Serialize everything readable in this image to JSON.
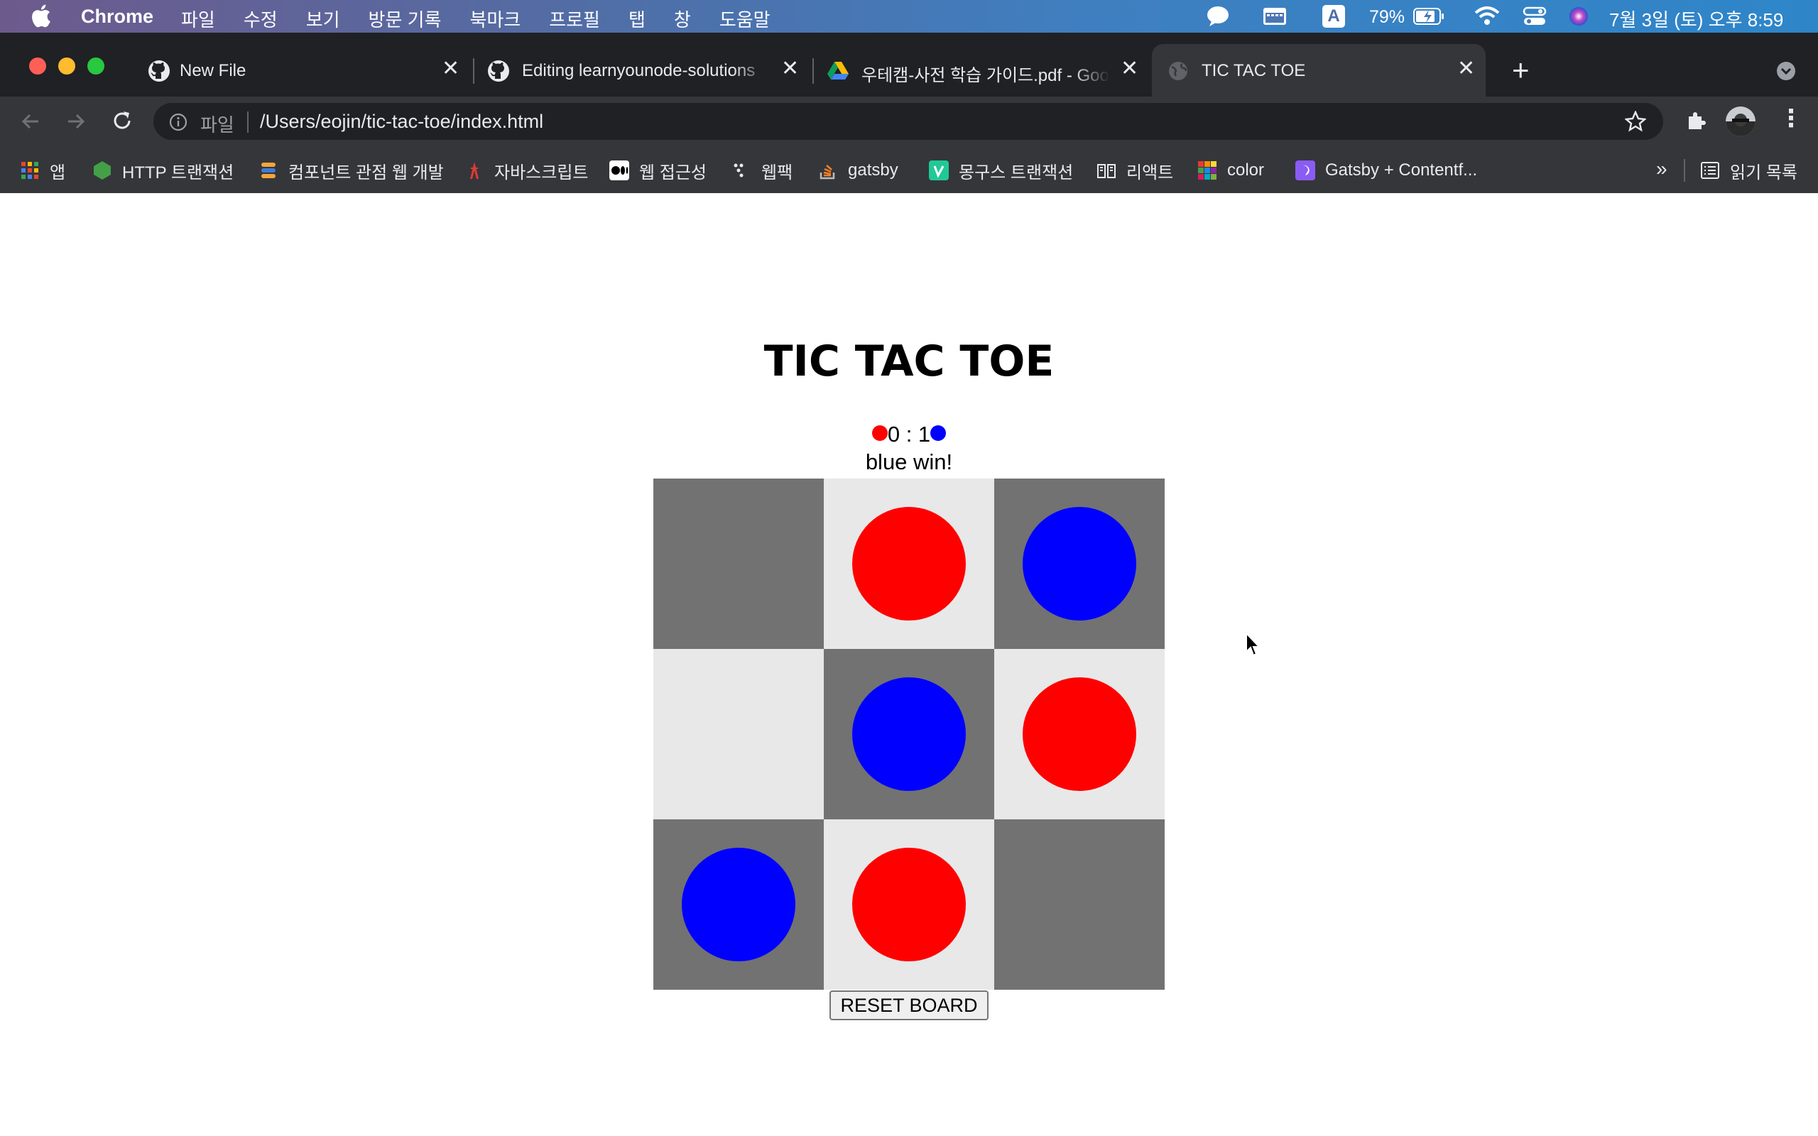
{
  "menubar": {
    "app_name": "Chrome",
    "menus": [
      "파일",
      "수정",
      "보기",
      "방문 기록",
      "북마크",
      "프로필",
      "탭",
      "창",
      "도움말"
    ],
    "input_source": "A",
    "battery": "79%",
    "datetime": "7월 3일 (토) 오후 8:59"
  },
  "tabs": [
    {
      "title": "New File",
      "icon": "github-icon",
      "active": false
    },
    {
      "title": "Editing learnyounode-solutions",
      "icon": "github-icon",
      "active": false
    },
    {
      "title": "우테캠-사전 학습 가이드.pdf - Goo",
      "icon": "google-drive-icon",
      "active": false
    },
    {
      "title": "TIC TAC TOE",
      "icon": "globe-icon",
      "active": true
    }
  ],
  "address_bar": {
    "scheme_label": "파일",
    "url": "/Users/eojin/tic-tac-toe/index.html"
  },
  "bookmarks": [
    {
      "label": "앱",
      "icon": "apps-grid-icon"
    },
    {
      "label": "HTTP 트랜잭션",
      "icon": "node-hexagon-icon"
    },
    {
      "label": "컴포넌트 관점 웹 개발",
      "icon": "stack-icon"
    },
    {
      "label": "자바스크립트",
      "icon": "tower-icon"
    },
    {
      "label": "웹 접근성",
      "icon": "medium-icon"
    },
    {
      "label": "웹팩",
      "icon": "dots-icon"
    },
    {
      "label": "gatsby",
      "icon": "stack-overflow-icon"
    },
    {
      "label": "몽구스 트랜잭션",
      "icon": "velog-icon"
    },
    {
      "label": "리액트",
      "icon": "book-icon"
    },
    {
      "label": "color",
      "icon": "color-grid-icon"
    },
    {
      "label": "Gatsby + Contentf...",
      "icon": "contentful-icon"
    }
  ],
  "bookmarks_overflow": "»",
  "reading_list": "읽기 목록",
  "game": {
    "title": "TIC TAC TOE",
    "score_red": "0",
    "score_separator": " : ",
    "score_blue": "1",
    "status": "blue win!",
    "reset_label": "RESET BOARD",
    "colors": {
      "red": "#ff0000",
      "blue": "#0000ff",
      "dark_cell": "#727272",
      "light_cell": "#e8e8e8"
    },
    "board": [
      "",
      "red",
      "blue",
      "",
      "blue",
      "red",
      "blue",
      "red",
      ""
    ]
  }
}
